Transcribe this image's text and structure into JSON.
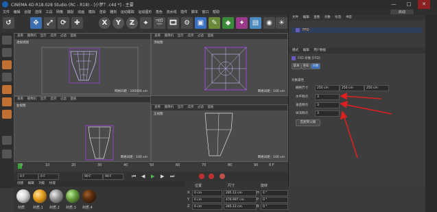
{
  "window": {
    "title": "CINEMA 4D R18.028 Studio (RC - R18) - [小梦？.c4d *] - 主要",
    "min": "—",
    "max": "□",
    "close": "✕"
  },
  "menu": [
    "文件",
    "编辑",
    "创建",
    "选择",
    "工具",
    "网格",
    "捕捉",
    "动画",
    "模拟",
    "渲染",
    "雕刻",
    "运动跟踪",
    "运动图形",
    "角色",
    "流水线",
    "插件",
    "脚本",
    "窗口",
    "帮助"
  ],
  "layout_label": "启动",
  "toolbar": {
    "x_label": "X",
    "y_label": "Y",
    "z_label": "Z"
  },
  "viewports": {
    "menu": [
      "查看",
      "摄像机",
      "显示",
      "选项",
      "过滤",
      "面板"
    ],
    "persp": {
      "label": "透视视图",
      "grid": "网格间距 : 100000 cm"
    },
    "top": {
      "label": "顶视图",
      "grid": "网格间距 : 100 cm"
    },
    "right": {
      "label": "右视图",
      "grid": "网格间距 : 100 cm"
    },
    "front": {
      "label": "正视图",
      "grid": "网格间距 : 100 cm"
    }
  },
  "object_manager": {
    "tabs": [
      "文件",
      "编辑",
      "查看",
      "对象",
      "标签",
      "书签"
    ],
    "item": "FFD"
  },
  "attribute_manager": {
    "tabs": [
      "模式",
      "编辑",
      "用户数据"
    ],
    "object_title": "FFD 对象 [FFD]",
    "subtabs": [
      "基本",
      "坐标",
      "对象"
    ],
    "section": "对象属性",
    "grid_size_label": "栅格尺寸",
    "grid_size": [
      "250 cm",
      "250 cm",
      "250 cm"
    ],
    "h_grid_label": "水平网点",
    "h_grid": "3",
    "v_grid_label": "垂直网点",
    "v_grid": "3",
    "d_grid_label": "纵深网点",
    "d_grid": "3",
    "fit_button": "匹配到父级"
  },
  "timeline": {
    "ticks": [
      "0",
      "10",
      "20",
      "30",
      "40",
      "50",
      "60",
      "70",
      "80",
      "90"
    ],
    "frame_end": "0 F"
  },
  "playback": {
    "start": "0 F",
    "current": "0 F",
    "end": "90 F",
    "end2": "90 F"
  },
  "materials": {
    "tabs": [
      "创建",
      "编辑",
      "功能",
      "纹理"
    ],
    "items": [
      {
        "name": "材质",
        "color": "#d8d8d8"
      },
      {
        "name": "材质.1",
        "color": "#e8a020"
      },
      {
        "name": "材质.2",
        "color": "#9a9a9a"
      },
      {
        "name": "材质.3",
        "color": "#6aa040"
      },
      {
        "name": "材质.4",
        "color": "#5a3010"
      }
    ]
  },
  "coords": {
    "headers": [
      "位置",
      "尺寸",
      "旋转"
    ],
    "rows": [
      {
        "axis": "X",
        "pos": "0 cm",
        "size": "285.12 cm",
        "rot_axis": "H",
        "rot": "0 °"
      },
      {
        "axis": "Y",
        "pos": "0 cm",
        "size": "476.997 cm",
        "rot_axis": "P",
        "rot": "0 °"
      },
      {
        "axis": "Z",
        "pos": "0 cm",
        "size": "285.12 cm",
        "rot_axis": "B",
        "rot": "0 °"
      }
    ]
  }
}
